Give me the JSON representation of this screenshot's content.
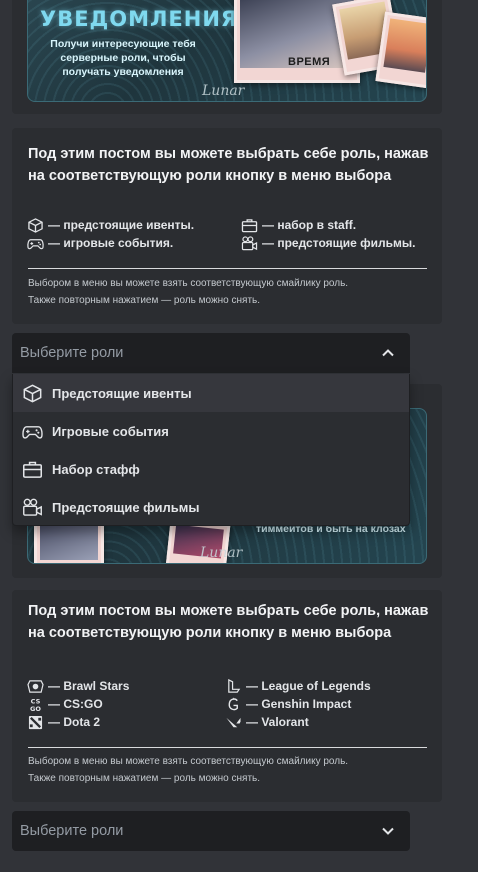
{
  "colors": {
    "page_bg": "#313338",
    "embed_bg": "#2b2d31",
    "select_bg": "#1e1f22",
    "banner_accent": "#7fd9ef"
  },
  "banner_top": {
    "title": "УВЕДОМЛЕНИЯ",
    "subtitle": "Получи интересующие тебя серверные роли, чтобы получать уведомления",
    "photo_word": "ВРЕМЯ",
    "signature": "Lunar"
  },
  "embed1": {
    "title": "Под этим постом вы можете выбрать себе роль, нажав на соответствующую роли кнопку в меню выбора",
    "legend": [
      {
        "icon": "cube-icon",
        "text": "— предстоящие ивенты."
      },
      {
        "icon": "briefcase-icon",
        "text": "— набор в staff."
      },
      {
        "icon": "gamepad-icon",
        "text": "— игровые события."
      },
      {
        "icon": "camera-icon",
        "text": "— предстоящие фильмы."
      }
    ],
    "note_line1": "Выбором в меню вы можете взять соответствующую смайлику роль.",
    "note_line2": "Также повторным нажатием — роль можно снять."
  },
  "select1": {
    "placeholder": "Выберите роли",
    "state": "open",
    "options": [
      {
        "icon": "cube-icon",
        "label": "Предстоящие ивенты"
      },
      {
        "icon": "gamepad-icon",
        "label": "Игровые события"
      },
      {
        "icon": "briefcase-icon",
        "label": "Набор стафф"
      },
      {
        "icon": "camera-icon",
        "label": "Предстоящие фильмы"
      }
    ]
  },
  "banner_mid": {
    "tail_text": "тиммейтов и быть на клозах",
    "signature": "Lunar"
  },
  "embed2": {
    "title": "Под этим постом вы можете выбрать себе роль, нажав на соответствующую роли кнопку в меню выбора",
    "legend": [
      {
        "icon": "brawl-stars-icon",
        "text": "— Brawl Stars"
      },
      {
        "icon": "league-of-legends-icon",
        "text": "— League of Legends"
      },
      {
        "icon": "csgo-icon",
        "text": "— CS:GO",
        "glyph": "CS\nGO"
      },
      {
        "icon": "genshin-impact-icon",
        "text": "— Genshin Impact"
      },
      {
        "icon": "dota2-icon",
        "text": "— Dota 2"
      },
      {
        "icon": "valorant-icon",
        "text": "— Valorant"
      }
    ],
    "note_line1": "Выбором в меню вы можете взять соответствующую смайлику роль.",
    "note_line2": "Также повторным нажатием — роль можно снять."
  },
  "select2": {
    "placeholder": "Выберите роли",
    "state": "closed"
  }
}
